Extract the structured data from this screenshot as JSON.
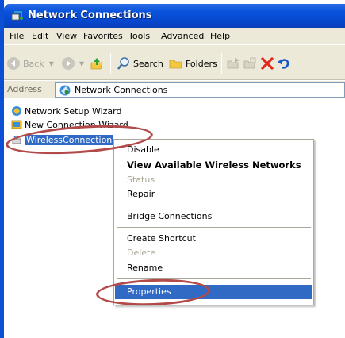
{
  "window": {
    "title": "Network Connections"
  },
  "menu": [
    "File",
    "Edit",
    "View",
    "Favorites",
    "Tools",
    "Advanced",
    "Help"
  ],
  "toolbar": {
    "back_label": "Back",
    "search_label": "Search",
    "folders_label": "Folders"
  },
  "address": {
    "label": "Address",
    "value": "Network Connections"
  },
  "items": {
    "setup_wizard": "Network Setup Wizard",
    "new_connection_wizard": "New Connection Wizard",
    "wireless_connection": "WirelessConnection"
  },
  "context_menu": {
    "disable": "Disable",
    "view_networks": "View Available Wireless Networks",
    "status": "Status",
    "repair": "Repair",
    "bridge": "Bridge Connections",
    "create_shortcut": "Create Shortcut",
    "delete": "Delete",
    "rename": "Rename",
    "properties": "Properties"
  },
  "colors": {
    "title_bar": "#0a54dc",
    "selection": "#316ac5",
    "annotation_ring": "#b24a4a",
    "chrome": "#ece9d8"
  }
}
